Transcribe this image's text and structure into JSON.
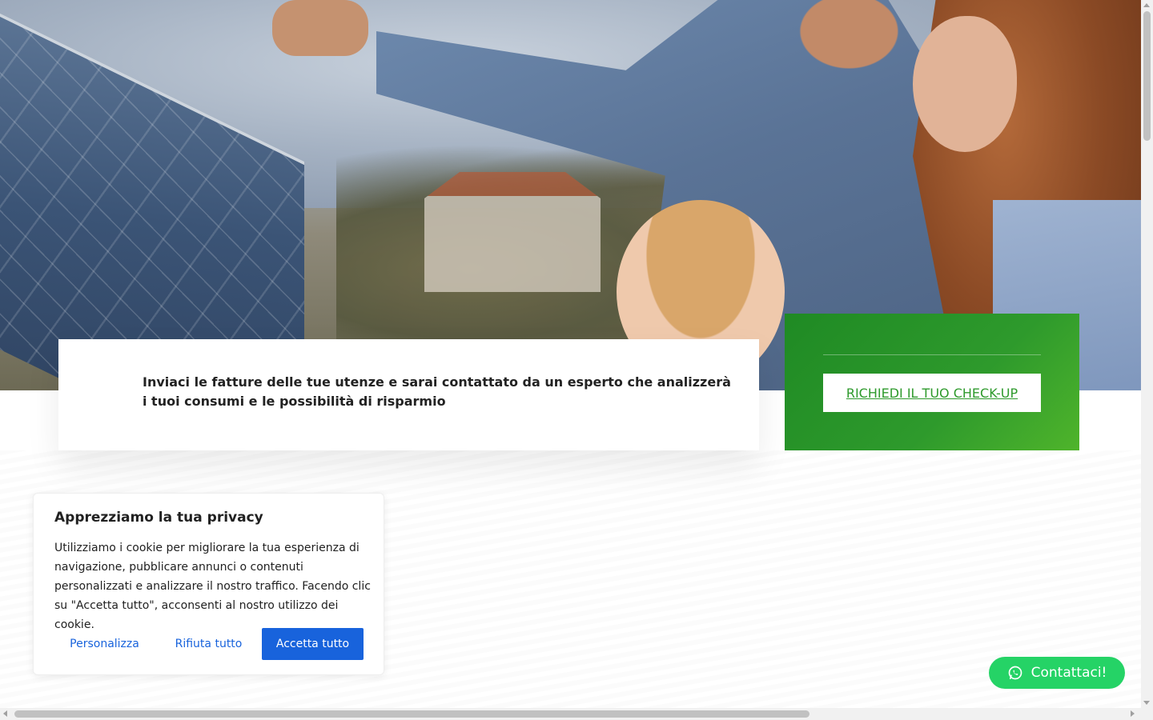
{
  "hero": {
    "image_alt": "Family with solar panels"
  },
  "info_card": {
    "text": "Inviaci le fatture delle tue utenze e sarai contattato da un esperto che analizzerà i tuoi consumi e le possibilità di risparmio"
  },
  "cta": {
    "button_label": "RICHIEDI IL TUO CHECK-UP"
  },
  "cookie_banner": {
    "title": "Apprezziamo la tua privacy",
    "body": "Utilizziamo i cookie per migliorare la tua esperienza di navigazione, pubblicare annunci o contenuti personalizzati e analizzare il nostro traffico. Facendo clic su \"Accetta tutto\", acconsenti al nostro utilizzo dei cookie.",
    "customize_label": "Personalizza",
    "reject_label": "Rifiuta tutto",
    "accept_label": "Accetta tutto"
  },
  "whatsapp": {
    "label": "Contattaci!",
    "icon": "whatsapp-icon"
  },
  "colors": {
    "green": "#2e9a2c",
    "cookie_blue": "#1863dc",
    "whatsapp_green": "#25d366"
  }
}
